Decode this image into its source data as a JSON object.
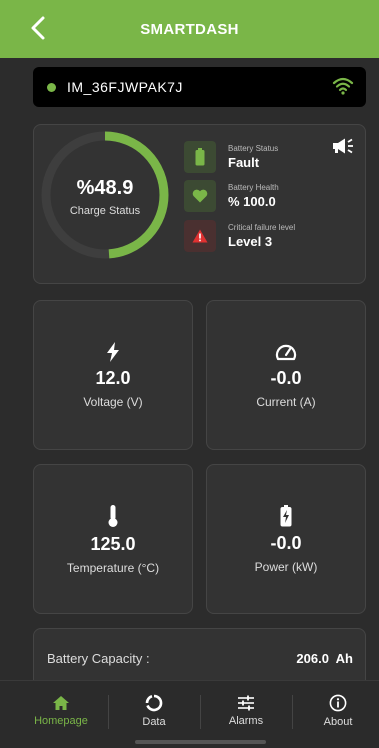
{
  "header": {
    "title": "SMARTDASH"
  },
  "device": {
    "id": "IM_36FJWPAK7J"
  },
  "status": {
    "charge_percent": 48.9,
    "charge_value": "%48.9",
    "charge_label": "Charge Status",
    "battery_status_label": "Battery Status",
    "battery_status_value": "Fault",
    "battery_health_label": "Battery Health",
    "battery_health_value": "% 100.0",
    "critical_label": "Critical failure level",
    "critical_value": "Level 3"
  },
  "metrics": [
    {
      "value": "12.0",
      "label": "Voltage (V)",
      "icon": "bolt-icon"
    },
    {
      "value": "-0.0",
      "label": "Current (A)",
      "icon": "speedometer-icon"
    },
    {
      "value": "125.0",
      "label": "Temperature (°C)",
      "icon": "thermometer-icon"
    },
    {
      "value": "-0.0",
      "label": "Power (kW)",
      "icon": "battery-charging-icon"
    }
  ],
  "capacity": {
    "label": "Battery Capacity :",
    "value": "206.0  Ah"
  },
  "tabs": [
    {
      "label": "Homepage",
      "icon": "home-icon"
    },
    {
      "label": "Data",
      "icon": "chart-icon"
    },
    {
      "label": "Alarms",
      "icon": "sliders-icon"
    },
    {
      "label": "About",
      "icon": "info-icon"
    }
  ],
  "colors": {
    "accent": "#7ab648",
    "danger": "#e03131",
    "background": "#2c2c2c",
    "card": "#333333"
  }
}
